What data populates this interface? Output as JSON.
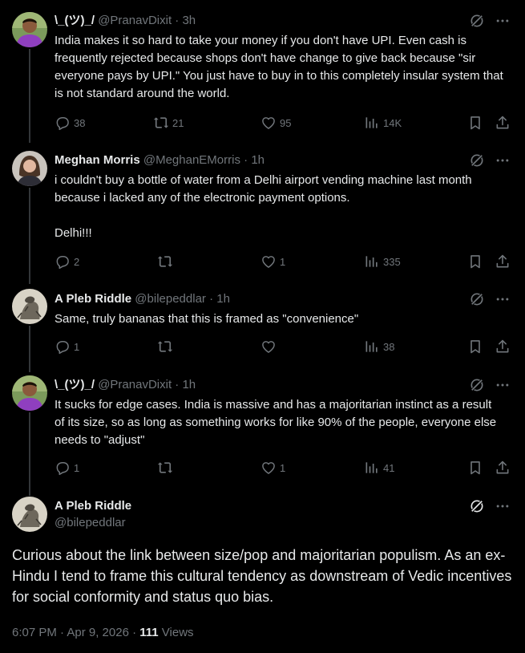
{
  "replies": [
    {
      "display_name": "\\_(ツ)_/",
      "handle": "@PranavDixit",
      "time": "3h",
      "text": "India makes it so hard to take your money if you don't have UPI. Even cash is frequently rejected because shops don't have change to give back because \"sir everyone pays by UPI.\" You just have to buy in to this completely insular system that is not standard around the world.",
      "replies": "38",
      "reposts": "21",
      "likes": "95",
      "views": "14K"
    },
    {
      "display_name": "Meghan Morris",
      "handle": "@MeghanEMorris",
      "time": "1h",
      "text_lines": [
        "i couldn't buy a bottle of water from a Delhi airport vending machine last month because i lacked any of the electronic payment options.",
        "Delhi!!!"
      ],
      "replies": "2",
      "reposts": "",
      "likes": "1",
      "views": "335"
    },
    {
      "display_name": "A Pleb Riddle",
      "handle": "@bilepeddlar",
      "time": "1h",
      "text": "Same, truly bananas that this is framed as \"convenience\"",
      "replies": "1",
      "reposts": "",
      "likes": "",
      "views": "38"
    },
    {
      "display_name": "\\_(ツ)_/",
      "handle": "@PranavDixit",
      "time": "1h",
      "text": "It sucks for edge cases. India is massive and has a majoritarian instinct as a result of its size, so as long as something works for like 90% of the people, everyone else needs to \"adjust\"",
      "replies": "1",
      "reposts": "",
      "likes": "1",
      "views": "41"
    }
  ],
  "main": {
    "display_name": "A Pleb Riddle",
    "handle": "@bilepeddlar",
    "text": "Curious about the link between size/pop and majoritarian populism. As an ex-Hindu I tend to frame this cultural tendency as downstream of Vedic incentives for social conformity and status quo bias.",
    "timestamp": "6:07 PM · Apr 9, 2026 · ",
    "views_count": "111",
    "views_label": " Views"
  },
  "icons": {
    "grok": "grok-icon",
    "more": "more-icon",
    "reply": "reply-icon",
    "repost": "repost-icon",
    "like": "like-icon",
    "views": "views-icon",
    "bookmark": "bookmark-icon",
    "share": "share-icon"
  },
  "colors": {
    "background": "#000000",
    "text": "#e7e9ea",
    "muted": "#71767b",
    "thread_line": "#333639"
  }
}
